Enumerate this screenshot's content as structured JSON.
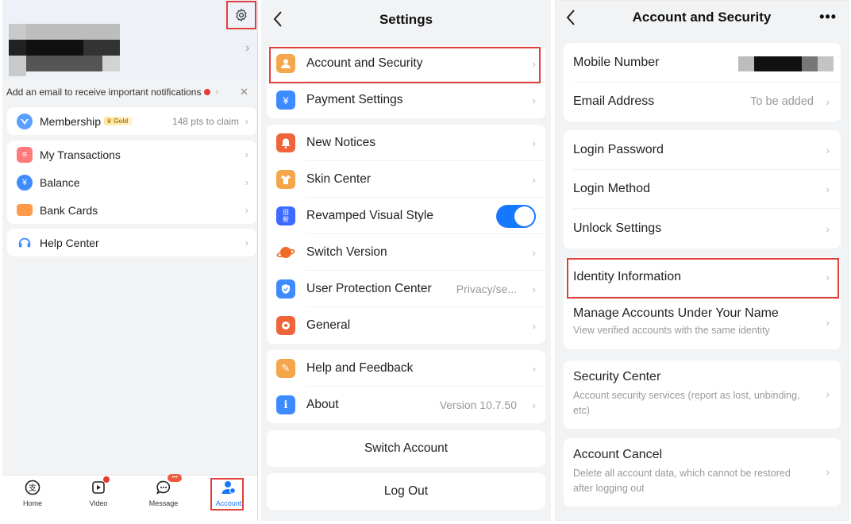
{
  "screen1": {
    "notification": "Add an email to receive important notifications",
    "membership": {
      "label": "Membership",
      "badge": "Gold",
      "points": "148 pts to claim"
    },
    "menu": [
      {
        "label": "My Transactions",
        "icon": "transactions-icon",
        "color": "#ff7a7a"
      },
      {
        "label": "Balance",
        "icon": "balance-icon",
        "color": "#3d8bff"
      },
      {
        "label": "Bank Cards",
        "icon": "bank-card-icon",
        "color": "#ff9a4a"
      }
    ],
    "help": "Help Center",
    "nav": [
      {
        "label": "Home"
      },
      {
        "label": "Video"
      },
      {
        "label": "Message",
        "badge": "•••"
      },
      {
        "label": "Account"
      }
    ],
    "colors": {
      "accent": "#1677ff",
      "highlight": "#e0403a"
    }
  },
  "screen2": {
    "title": "Settings",
    "group1": [
      {
        "label": "Account and Security",
        "color": "#f5a64a",
        "glyph": "👤"
      },
      {
        "label": "Payment Settings",
        "color": "#3d8bff",
        "glyph": "¥"
      }
    ],
    "group2": [
      {
        "label": "New Notices",
        "color": "#f0643a",
        "glyph": "🔔"
      },
      {
        "label": "Skin Center",
        "color": "#f5a64a",
        "glyph": "👕"
      },
      {
        "label": "Revamped Visual Style",
        "color": "#3d6bff",
        "glyph": "旧新"
      },
      {
        "label": "Switch Version",
        "color": "#f06a2a",
        "glyph": "🪐"
      },
      {
        "label": "User Protection Center",
        "value": "Privacy/se...",
        "color": "#3d8bff",
        "glyph": "🛡"
      },
      {
        "label": "General",
        "color": "#f0643a",
        "glyph": "⚙"
      }
    ],
    "group3": [
      {
        "label": "Help and Feedback",
        "color": "#f5a64a",
        "glyph": "✎"
      },
      {
        "label": "About",
        "value": "Version 10.7.50",
        "color": "#3d8bff",
        "glyph": "i"
      }
    ],
    "switch_account": "Switch Account",
    "log_out": "Log Out"
  },
  "screen3": {
    "title": "Account and Security",
    "mobile": "Mobile Number",
    "email": {
      "label": "Email Address",
      "value": "To be added"
    },
    "group2": [
      "Login Password",
      "Login Method",
      "Unlock Settings"
    ],
    "identity": "Identity Information",
    "manage": {
      "title": "Manage Accounts Under Your Name",
      "sub": "View verified accounts with the same identity"
    },
    "security": {
      "title": "Security Center",
      "sub": "Account security services (report as lost, unbinding, etc)"
    },
    "cancel": {
      "title": "Account Cancel",
      "sub": "Delete all account data, which cannot be restored after logging out"
    }
  }
}
